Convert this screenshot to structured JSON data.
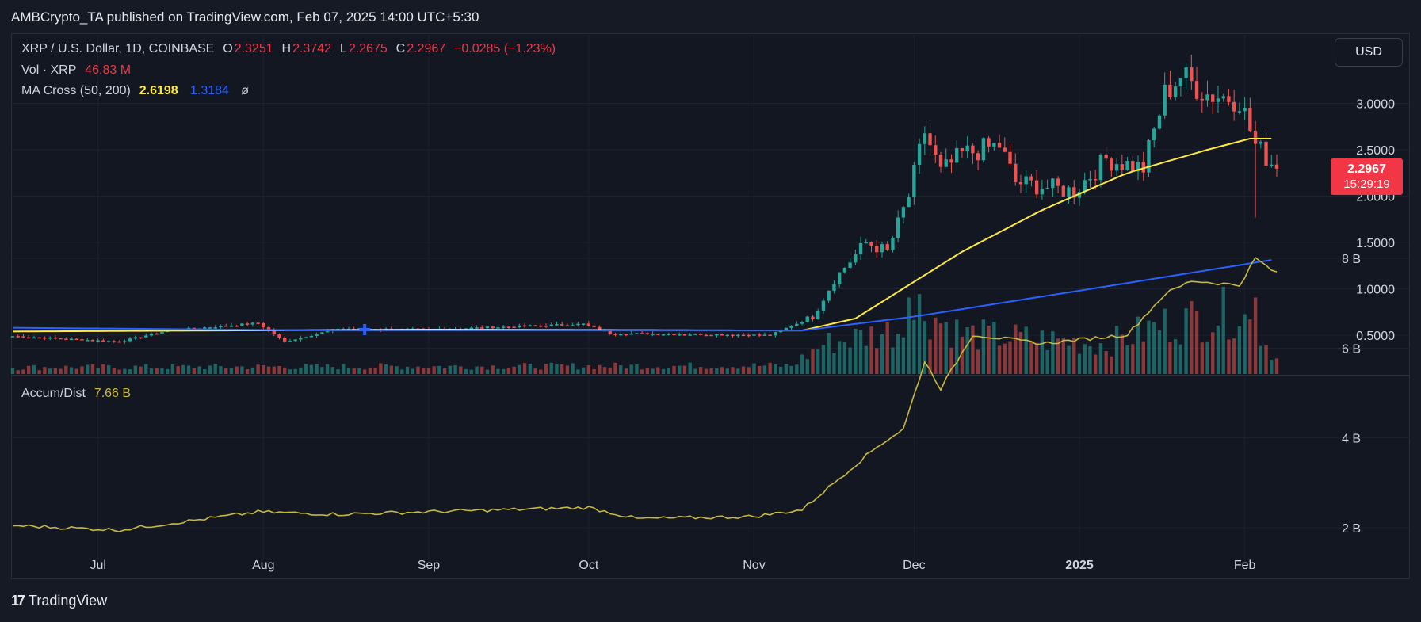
{
  "header": {
    "published": "AMBCrypto_TA published on TradingView.com, Feb 07, 2025 14:00 UTC+5:30"
  },
  "legend": {
    "symbol": "XRP / U.S. Dollar, 1D, COINBASE",
    "o_label": "O",
    "o": "2.3251",
    "h_label": "H",
    "h": "2.3742",
    "l_label": "L",
    "l": "2.2675",
    "c_label": "C",
    "c": "2.2967",
    "change": "−0.0285 (−1.23%)",
    "vol_label": "Vol · XRP",
    "vol": "46.83 M",
    "ma_label": "MA Cross (50, 200)",
    "ma50": "2.6198",
    "ma200": "1.3184",
    "ma_extra": "ø",
    "ad_label": "Accum/Dist",
    "ad": "7.66 B"
  },
  "currency_button": "USD",
  "price_tag": {
    "price": "2.2967",
    "countdown": "15:29:19"
  },
  "footer": {
    "logo_mark": "17",
    "brand": "TradingView"
  },
  "colors": {
    "up": "#26a69a",
    "down": "#ef5350",
    "ma50": "#ffeb3b",
    "ma200": "#2962ff",
    "ad": "#c9b93a",
    "bg": "#131722",
    "grid": "#1e2230"
  },
  "chart_data": [
    {
      "type": "candlestick",
      "title": "XRP / U.S. Dollar, 1D, COINBASE",
      "y_ticks": [
        "0.5000",
        "1.0000",
        "1.5000",
        "2.0000",
        "2.5000",
        "3.0000"
      ],
      "x_ticks": [
        "Jul",
        "Aug",
        "Sep",
        "Oct",
        "Nov",
        "Dec",
        "2025",
        "Feb"
      ],
      "ylim": [
        0.1,
        3.5
      ],
      "anchors": [
        {
          "date": "2024-06-15",
          "close": 0.49
        },
        {
          "date": "2024-07-05",
          "close": 0.43
        },
        {
          "date": "2024-07-14",
          "close": 0.55
        },
        {
          "date": "2024-07-31",
          "close": 0.63
        },
        {
          "date": "2024-08-05",
          "close": 0.43
        },
        {
          "date": "2024-08-15",
          "close": 0.57
        },
        {
          "date": "2024-09-01",
          "close": 0.56
        },
        {
          "date": "2024-09-30",
          "close": 0.62
        },
        {
          "date": "2024-10-05",
          "close": 0.52
        },
        {
          "date": "2024-11-04",
          "close": 0.5
        },
        {
          "date": "2024-11-12",
          "close": 0.7
        },
        {
          "date": "2024-11-16",
          "close": 1.1
        },
        {
          "date": "2024-11-22",
          "close": 1.5
        },
        {
          "date": "2024-11-26",
          "close": 1.4
        },
        {
          "date": "2024-11-30",
          "close": 2.0
        },
        {
          "date": "2024-12-03",
          "close": 2.7
        },
        {
          "date": "2024-12-06",
          "close": 2.25
        },
        {
          "date": "2024-12-10",
          "close": 2.45
        },
        {
          "date": "2024-12-17",
          "close": 2.55
        },
        {
          "date": "2024-12-20",
          "close": 2.15
        },
        {
          "date": "2024-12-31",
          "close": 2.05
        },
        {
          "date": "2025-01-06",
          "close": 2.4
        },
        {
          "date": "2025-01-13",
          "close": 2.3
        },
        {
          "date": "2025-01-17",
          "close": 3.1
        },
        {
          "date": "2025-01-20",
          "close": 3.3
        },
        {
          "date": "2025-01-25",
          "close": 3.1
        },
        {
          "date": "2025-01-31",
          "close": 3.05
        },
        {
          "date": "2025-02-03",
          "close": 2.55
        },
        {
          "date": "2025-02-07",
          "close": 2.3
        }
      ],
      "series": [
        {
          "name": "MA 50",
          "anchors": [
            [
              "2024-06-15",
              0.54
            ],
            [
              "2024-09-01",
              0.56
            ],
            [
              "2024-11-10",
              0.55
            ],
            [
              "2024-11-20",
              0.68
            ],
            [
              "2024-12-10",
              1.4
            ],
            [
              "2024-12-25",
              1.85
            ],
            [
              "2025-01-10",
              2.25
            ],
            [
              "2025-01-25",
              2.5
            ],
            [
              "2025-02-02",
              2.62
            ],
            [
              "2025-02-07",
              2.62
            ]
          ]
        },
        {
          "name": "MA 200",
          "anchors": [
            [
              "2024-06-15",
              0.58
            ],
            [
              "2024-08-15",
              0.55
            ],
            [
              "2024-11-10",
              0.55
            ],
            [
              "2024-12-01",
              0.7
            ],
            [
              "2025-01-01",
              0.98
            ],
            [
              "2025-02-07",
              1.32
            ]
          ]
        }
      ]
    },
    {
      "type": "bar",
      "name": "Vol · XRP",
      "last_value": "46.83 M",
      "anchors": [
        [
          "2024-06-15",
          20
        ],
        [
          "2024-11-08",
          25
        ],
        [
          "2024-11-14",
          90
        ],
        [
          "2024-11-30",
          140
        ],
        [
          "2024-12-02",
          200
        ],
        [
          "2024-12-10",
          120
        ],
        [
          "2025-01-06",
          90
        ],
        [
          "2025-01-17",
          150
        ],
        [
          "2025-01-31",
          190
        ],
        [
          "2025-02-07",
          47
        ]
      ]
    },
    {
      "type": "line",
      "name": "Accum/Dist",
      "last_value": "7.66 B",
      "y_ticks": [
        "2 B",
        "4 B",
        "6 B",
        "8 B"
      ],
      "ylim": [
        1.2,
        8.6
      ],
      "points": [
        [
          "2024-06-15",
          2.05
        ],
        [
          "2024-07-05",
          1.95
        ],
        [
          "2024-07-31",
          2.35
        ],
        [
          "2024-08-15",
          2.3
        ],
        [
          "2024-10-01",
          2.45
        ],
        [
          "2024-10-10",
          2.2
        ],
        [
          "2024-11-01",
          2.25
        ],
        [
          "2024-11-10",
          2.4
        ],
        [
          "2024-11-18",
          3.2
        ],
        [
          "2024-11-24",
          3.8
        ],
        [
          "2024-11-29",
          4.2
        ],
        [
          "2024-12-03",
          5.7
        ],
        [
          "2024-12-06",
          5.1
        ],
        [
          "2024-12-12",
          6.3
        ],
        [
          "2024-12-25",
          6.1
        ],
        [
          "2025-01-10",
          6.3
        ],
        [
          "2025-01-17",
          7.2
        ],
        [
          "2025-01-22",
          7.5
        ],
        [
          "2025-01-31",
          7.4
        ],
        [
          "2025-02-03",
          8.0
        ],
        [
          "2025-02-07",
          7.66
        ]
      ]
    }
  ]
}
